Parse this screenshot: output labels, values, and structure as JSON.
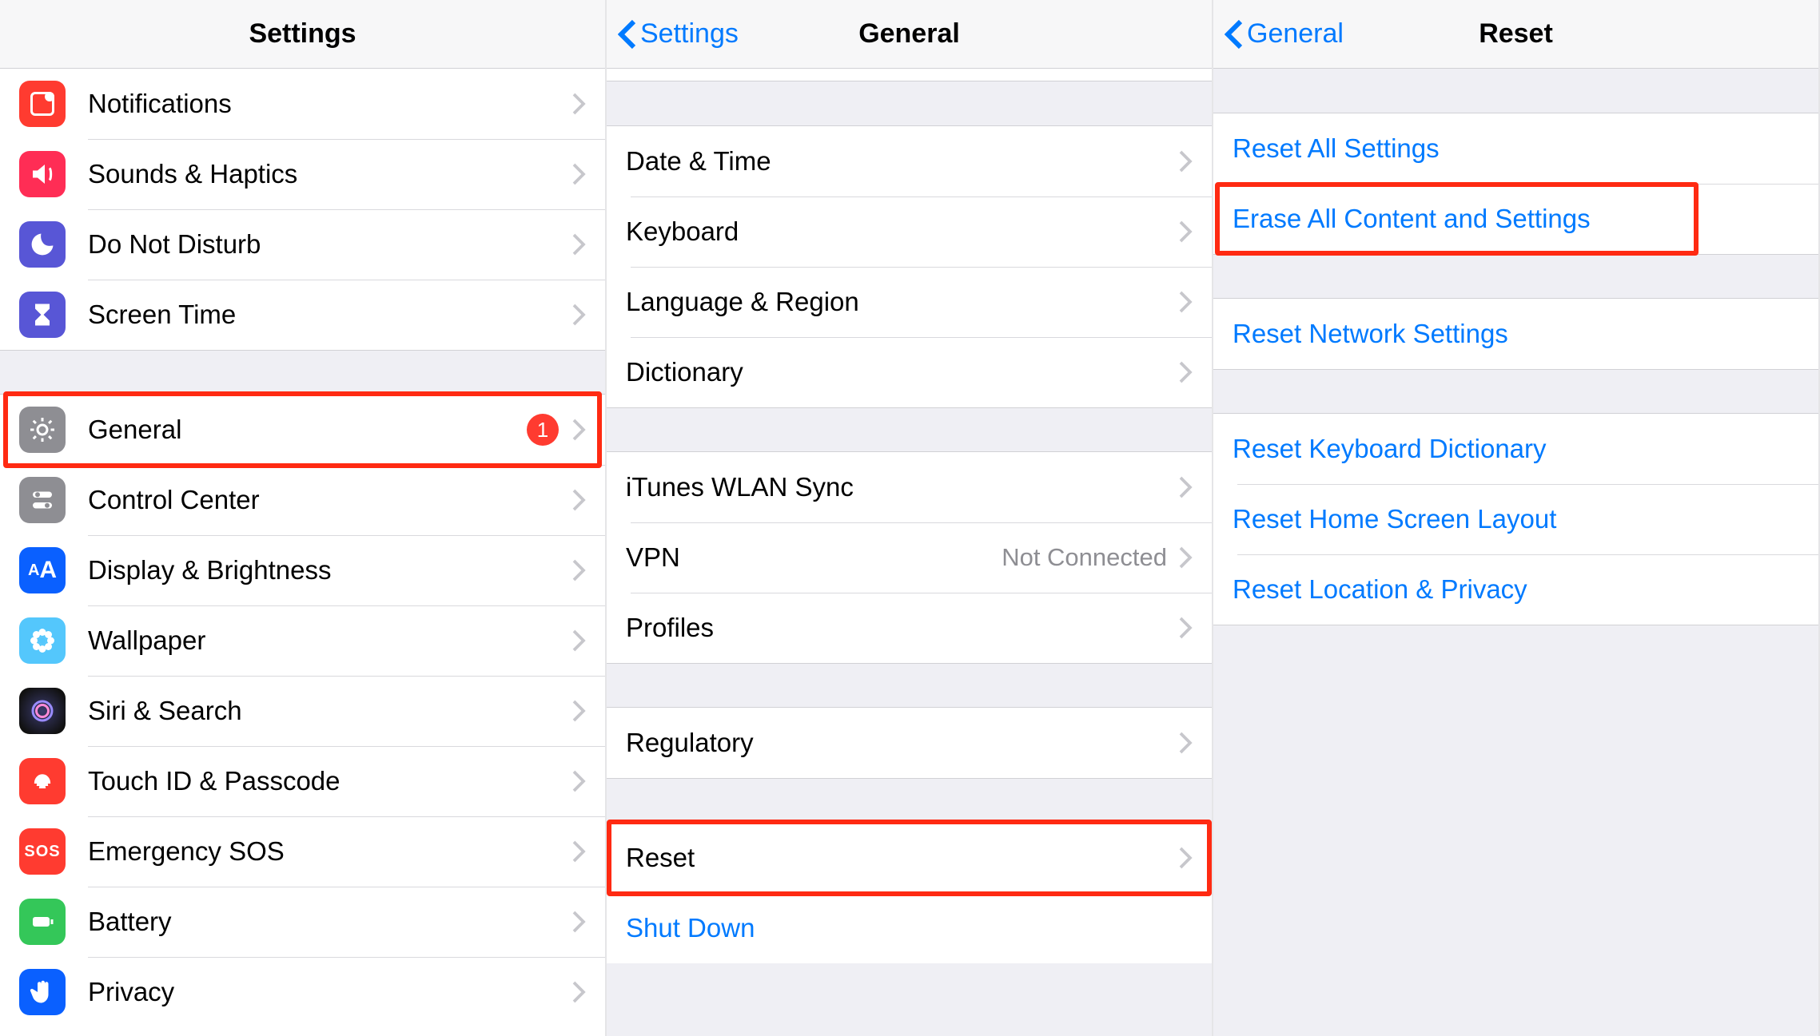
{
  "panes": {
    "settings": {
      "title": "Settings",
      "group1": [
        {
          "id": "notifications",
          "label": "Notifications"
        },
        {
          "id": "sounds",
          "label": "Sounds & Haptics"
        },
        {
          "id": "dnd",
          "label": "Do Not Disturb"
        },
        {
          "id": "screentime",
          "label": "Screen Time"
        }
      ],
      "group2": [
        {
          "id": "general",
          "label": "General",
          "badge": "1",
          "highlight": true
        },
        {
          "id": "controlcenter",
          "label": "Control Center"
        },
        {
          "id": "display",
          "label": "Display & Brightness"
        },
        {
          "id": "wallpaper",
          "label": "Wallpaper"
        },
        {
          "id": "siri",
          "label": "Siri & Search"
        },
        {
          "id": "touchid",
          "label": "Touch ID & Passcode"
        },
        {
          "id": "sos",
          "label": "Emergency SOS"
        },
        {
          "id": "battery",
          "label": "Battery"
        },
        {
          "id": "privacy",
          "label": "Privacy"
        }
      ]
    },
    "general": {
      "back": "Settings",
      "title": "General",
      "group1": [
        {
          "id": "datetime",
          "label": "Date & Time"
        },
        {
          "id": "keyboard",
          "label": "Keyboard"
        },
        {
          "id": "language",
          "label": "Language & Region"
        },
        {
          "id": "dictionary",
          "label": "Dictionary"
        }
      ],
      "group2": [
        {
          "id": "ituneswlan",
          "label": "iTunes WLAN Sync"
        },
        {
          "id": "vpn",
          "label": "VPN",
          "value": "Not Connected"
        },
        {
          "id": "profiles",
          "label": "Profiles"
        }
      ],
      "group3": [
        {
          "id": "regulatory",
          "label": "Regulatory"
        }
      ],
      "group4": [
        {
          "id": "reset",
          "label": "Reset",
          "highlight": true
        },
        {
          "id": "shutdown",
          "label": "Shut Down",
          "link": true,
          "noChevron": true
        }
      ]
    },
    "reset": {
      "back": "General",
      "title": "Reset",
      "group1": [
        {
          "id": "resetall",
          "label": "Reset All Settings",
          "link": true
        },
        {
          "id": "eraseall",
          "label": "Erase All Content and Settings",
          "link": true,
          "highlight": true
        }
      ],
      "group2": [
        {
          "id": "resetnetwork",
          "label": "Reset Network Settings",
          "link": true
        }
      ],
      "group3": [
        {
          "id": "resetkeyboard",
          "label": "Reset Keyboard Dictionary",
          "link": true
        },
        {
          "id": "resethome",
          "label": "Reset Home Screen Layout",
          "link": true
        },
        {
          "id": "resetlocation",
          "label": "Reset Location & Privacy",
          "link": true
        }
      ]
    }
  }
}
